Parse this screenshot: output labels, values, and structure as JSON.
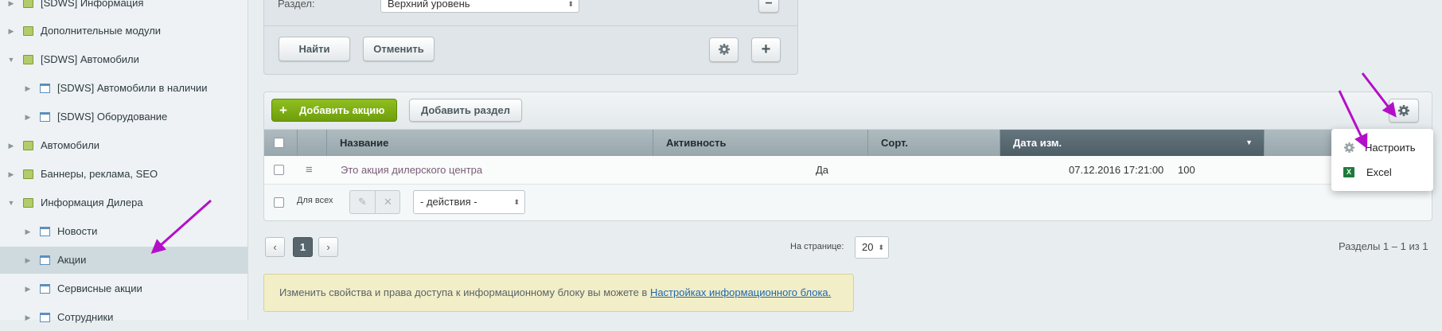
{
  "sidebar": {
    "items": [
      {
        "label": "[SDWS] Информация",
        "icon": "folder-icon"
      },
      {
        "label": "Дополнительные модули",
        "icon": "folder-icon"
      },
      {
        "label": "[SDWS] Автомобили",
        "icon": "folder-icon"
      },
      {
        "label": "[SDWS] Автомобили в наличии",
        "icon": "page-icon"
      },
      {
        "label": "[SDWS] Оборудование",
        "icon": "page-icon"
      },
      {
        "label": "Автомобили",
        "icon": "folder-icon"
      },
      {
        "label": "Баннеры, реклама, SEO",
        "icon": "folder-icon"
      },
      {
        "label": "Информация Дилера",
        "icon": "folder-icon"
      },
      {
        "label": "Новости",
        "icon": "page-icon"
      },
      {
        "label": "Акции",
        "icon": "page-icon"
      },
      {
        "label": "Сервисные акции",
        "icon": "page-icon"
      },
      {
        "label": "Сотрудники",
        "icon": "page-icon"
      }
    ]
  },
  "filter": {
    "section_label": "Раздел:",
    "section_value": "Верхний уровень",
    "find_button": "Найти",
    "cancel_button": "Отменить",
    "minus_symbol": "−",
    "plus_symbol": "+"
  },
  "toolbar": {
    "add_action_button": "Добавить акцию",
    "add_section_button": "Добавить раздел"
  },
  "table": {
    "columns": [
      "Название",
      "Активность",
      "Сорт.",
      "Дата изм."
    ],
    "sorted_column": "Дата изм.",
    "rows": [
      {
        "name": "Это акция дилерского центра",
        "active": "Да",
        "sort": "100",
        "date": "07.12.2016 17:21:00"
      }
    ],
    "for_all_label": "Для всех",
    "actions_select": "- действия -"
  },
  "popup": {
    "items": [
      {
        "label": "Настроить",
        "icon": "gear-icon"
      },
      {
        "label": "Excel",
        "icon": "excel-icon"
      }
    ]
  },
  "pager": {
    "prev": "‹",
    "current_page": "1",
    "next": "›",
    "per_page_label": "На странице:",
    "per_page_value": "20",
    "summary": "Разделы 1 – 1 из 1"
  },
  "notice": {
    "text": "Изменить свойства и права доступа к информационному блоку вы можете в ",
    "link": "Настройках информационного блока."
  },
  "colors": {
    "accent_green": "#7aab14",
    "annotation_arrow": "#b40fc8",
    "header_sorted": "#56666d"
  }
}
